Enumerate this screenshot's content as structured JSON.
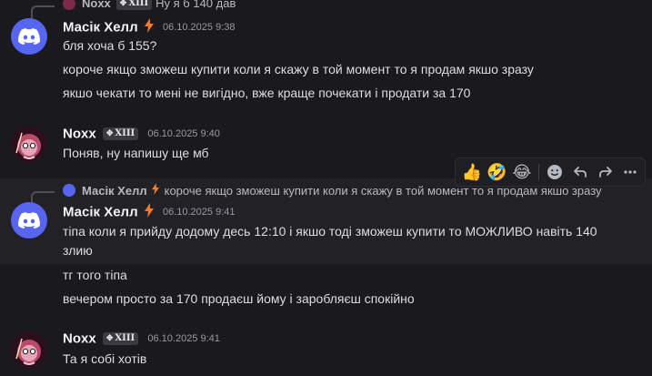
{
  "top_reply": {
    "author": "Noxx",
    "tag": "XIII",
    "text": "Ну я б 140 дав"
  },
  "messages": [
    {
      "author": "Масік Хелл",
      "timestamp": "06.10.2025 9:38",
      "lines": [
        "бля хоча б 155?",
        "короче якщо зможеш купити коли я скажу в той момент то я продам якшо зразу",
        "якшо чекати то мені не вигідно, вже краще почекати і продати за 170"
      ]
    },
    {
      "author": "Noxx",
      "tag": "XIII",
      "timestamp": "06.10.2025 9:40",
      "lines": [
        "Поняв, ну напишу ще мб"
      ]
    },
    {
      "reply": {
        "author": "Масік Хелл",
        "text": "короче якщо зможеш купити коли я скажу в той момент то я продам якшо зразу"
      },
      "author": "Масік Хелл",
      "timestamp": "06.10.2025 9:41",
      "lines": [
        "тіпа коли я прийду додому десь 12:10 і якшо тоді зможеш купити то МОЖЛИВО навіть 140",
        "злию",
        "тг того тіпа",
        "вечером просто за 170 продаєш йому і заробляєш спокійно"
      ]
    },
    {
      "author": "Noxx",
      "tag": "XIII",
      "timestamp": "06.10.2025 9:41",
      "lines": [
        "Та я собі хотів"
      ]
    }
  ],
  "toolbar": {
    "reactions": [
      "👍",
      "🤣",
      "😂"
    ],
    "icons": [
      "add-reaction-icon",
      "reply-icon",
      "forward-icon",
      "more-icon"
    ]
  },
  "colors": {
    "background": "#1a1a1e",
    "discord_blurple": "#5865f2",
    "bolt": "#f47b2a"
  }
}
